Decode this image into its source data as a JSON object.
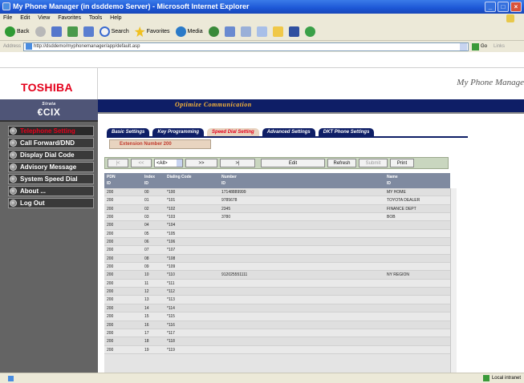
{
  "window": {
    "title": "My Phone Manager (in dsddemo Server) - Microsoft Internet Explorer"
  },
  "menubar": [
    "File",
    "Edit",
    "View",
    "Favorites",
    "Tools",
    "Help"
  ],
  "toolbar": {
    "back": "Back",
    "search": "Search",
    "favorites": "Favorites",
    "media": "Media"
  },
  "addressbar": {
    "label": "Address",
    "url": "http://dsddemo/myphonemanager/app/default.asp",
    "go": "Go",
    "links": "Links"
  },
  "header": {
    "brand": "TOSHIBA",
    "app_title": "My Phone Manage",
    "logo_line1": "Strata",
    "logo_line2": "CIX",
    "slogan": "Optimize Communication"
  },
  "sidebar": {
    "items": [
      {
        "label": "Telephone Setting",
        "active": true
      },
      {
        "label": "Call Forward/DND",
        "active": false
      },
      {
        "label": "Display Dial Code",
        "active": false
      },
      {
        "label": "Advisory Message",
        "active": false
      },
      {
        "label": "System Speed Dial",
        "active": false
      },
      {
        "label": "About ...",
        "active": false
      },
      {
        "label": "Log Out",
        "active": false
      }
    ]
  },
  "tabs": [
    {
      "label": "Basic Settings",
      "active": false
    },
    {
      "label": "Key Programming",
      "active": false
    },
    {
      "label": "Speed Dial Setting",
      "active": true
    },
    {
      "label": "Advanced Settings",
      "active": false
    },
    {
      "label": "DKT Phone Settings",
      "active": false
    }
  ],
  "extension": "Extension Number 200",
  "controls": {
    "first": "|<",
    "prev": "<<",
    "page_select": "<All>",
    "next": ">>",
    "last": ">|",
    "edit": "Edit",
    "refresh": "Refresh",
    "submit": "Submit",
    "print": "Print"
  },
  "table": {
    "headers": [
      {
        "title": "PDN",
        "sub": "ID"
      },
      {
        "title": "Index",
        "sub": "ID"
      },
      {
        "title": "Dialing Code",
        "sub": ""
      },
      {
        "title": "Number",
        "sub": "ID"
      },
      {
        "title": "Name",
        "sub": "ID"
      }
    ],
    "rows": [
      [
        "200",
        "00",
        "*100",
        "17148889999",
        "MY HOME"
      ],
      [
        "200",
        "01",
        "*101",
        "9785678",
        "TOYOTA DEALER"
      ],
      [
        "200",
        "02",
        "*102",
        "2345",
        "FINANCE DEPT"
      ],
      [
        "200",
        "03",
        "*103",
        "3780",
        "BOB"
      ],
      [
        "200",
        "04",
        "*104",
        "",
        ""
      ],
      [
        "200",
        "05",
        "*105",
        "",
        ""
      ],
      [
        "200",
        "06",
        "*106",
        "",
        ""
      ],
      [
        "200",
        "07",
        "*107",
        "",
        ""
      ],
      [
        "200",
        "08",
        "*108",
        "",
        ""
      ],
      [
        "200",
        "09",
        "*109",
        "",
        ""
      ],
      [
        "200",
        "10",
        "*110",
        "912025551111",
        "NY REGION"
      ],
      [
        "200",
        "11",
        "*111",
        "",
        ""
      ],
      [
        "200",
        "12",
        "*112",
        "",
        ""
      ],
      [
        "200",
        "13",
        "*113",
        "",
        ""
      ],
      [
        "200",
        "14",
        "*114",
        "",
        ""
      ],
      [
        "200",
        "15",
        "*115",
        "",
        ""
      ],
      [
        "200",
        "16",
        "*116",
        "",
        ""
      ],
      [
        "200",
        "17",
        "*117",
        "",
        ""
      ],
      [
        "200",
        "18",
        "*118",
        "",
        ""
      ],
      [
        "200",
        "19",
        "*119",
        "",
        ""
      ]
    ]
  },
  "status": {
    "zone": "Local intranet"
  }
}
